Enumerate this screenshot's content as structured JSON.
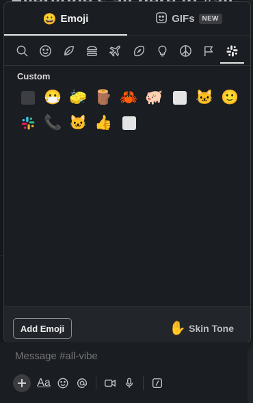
{
  "background": {
    "channel_heading": "Everyone's all here in #all-"
  },
  "tabs": [
    {
      "label": "Emoji",
      "icon": "smiley-icon",
      "active": true
    },
    {
      "label": "GIFs",
      "icon": "gif-sticker-icon",
      "badge": "NEW",
      "active": false
    }
  ],
  "categories": [
    {
      "name": "search",
      "icon": "search-icon"
    },
    {
      "name": "smileys",
      "icon": "smiley-face-icon"
    },
    {
      "name": "nature",
      "icon": "leaf-icon"
    },
    {
      "name": "food",
      "icon": "burger-icon"
    },
    {
      "name": "travel",
      "icon": "airplane-icon"
    },
    {
      "name": "activity",
      "icon": "football-icon"
    },
    {
      "name": "objects",
      "icon": "lightbulb-icon"
    },
    {
      "name": "symbols",
      "icon": "peace-icon"
    },
    {
      "name": "flags",
      "icon": "flag-icon"
    },
    {
      "name": "custom",
      "icon": "slack-icon",
      "active": true
    }
  ],
  "custom_section": {
    "title": "Custom",
    "emoji": [
      {
        "name": "dark-square",
        "glyph": "sq-dark"
      },
      {
        "name": "face-with-mouth-mask",
        "glyph": "😷"
      },
      {
        "name": "sponge",
        "glyph": "🧽"
      },
      {
        "name": "club",
        "glyph": "🪵"
      },
      {
        "name": "crab",
        "glyph": "🦀"
      },
      {
        "name": "pig",
        "glyph": "🐖"
      },
      {
        "name": "white-square",
        "glyph": "sq-white"
      },
      {
        "name": "cat-in-hat",
        "glyph": "🐱"
      },
      {
        "name": "slightly-smiling-face",
        "glyph": "🙂"
      },
      {
        "name": "slack-logo",
        "glyph": "slack"
      },
      {
        "name": "phone",
        "glyph": "📞"
      },
      {
        "name": "cat-in-hat-2",
        "glyph": "🐱"
      },
      {
        "name": "thumbs-up",
        "glyph": "👍"
      },
      {
        "name": "white-square-2",
        "glyph": "sq-white"
      }
    ]
  },
  "footer": {
    "add_emoji_label": "Add Emoji",
    "skin_tone_label": "Skin Tone",
    "skin_tone_hand": "✋"
  },
  "composer": {
    "placeholder": "Message #all-vibe",
    "format_label": "Aa"
  }
}
